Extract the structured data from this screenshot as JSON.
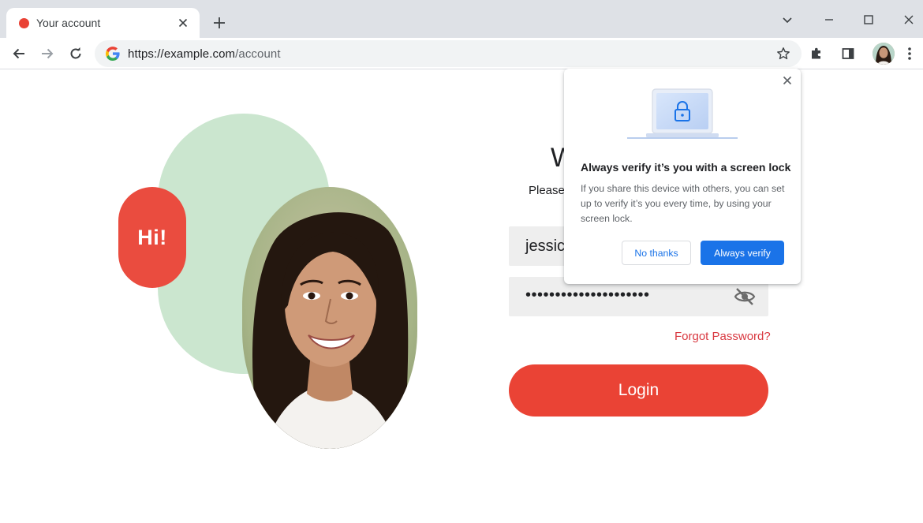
{
  "browser": {
    "tab": {
      "title": "Your account",
      "favicon_color": "#e94235"
    },
    "address_bar": {
      "host": "https://example.com",
      "path": "/account"
    }
  },
  "page": {
    "badge": "Hi!",
    "heading_partial": "W",
    "subtitle_partial": "Please",
    "username_value": "jessic",
    "password_mask": "•••••••••••••••••••••",
    "forgot_password": "Forgot Password?",
    "login_button": "Login",
    "accent_color": "#ea4335"
  },
  "popup": {
    "title": "Always verify it’s you with a screen lock",
    "body": "If you share this device with others, you can set up to verify it’s you every time, by using your screen lock.",
    "secondary_button": "No thanks",
    "primary_button": "Always verify",
    "primary_color": "#1a73e8"
  }
}
